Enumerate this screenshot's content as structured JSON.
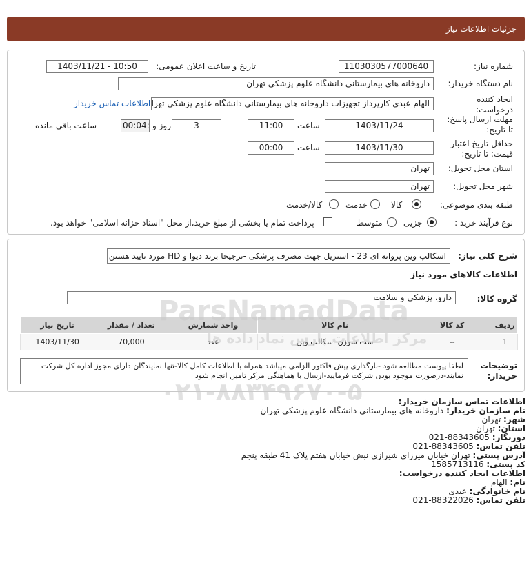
{
  "header": {
    "title": "جزئیات اطلاعات نیاز"
  },
  "form": {
    "need_number_label": "شماره نیاز:",
    "need_number": "1103030577000640",
    "announce_label": "تاریخ و ساعت اعلان عمومی:",
    "announce_value": "1403/11/21 - 10:50",
    "buyer_label": "نام دستگاه خریدار:",
    "buyer_value": "داروخانه های بیمارستانی دانشگاه علوم پزشکی تهران",
    "creator_label": "ایجاد کننده درخواست:",
    "creator_value": "الهام عبدی کارپرداز تجهیزات داروخانه های بیمارستانی دانشگاه علوم پزشکی تهران",
    "buyer_contact_link": "اطلاعات تماس خریدار",
    "deadline_label": "مهلت ارسال پاسخ: تا تاریخ:",
    "deadline_date": "1403/11/24",
    "time_label": "ساعت",
    "deadline_time": "11:00",
    "days_value": "3",
    "days_label": "روز و",
    "remaining_value": "00:04:35",
    "remaining_label": "ساعت باقی مانده",
    "validity_label": "حداقل تاریخ اعتبار قیمت: تا تاریخ:",
    "validity_date": "1403/11/30",
    "validity_time": "00:00",
    "province_label": "استان محل تحویل:",
    "province_value": "تهران",
    "city_label": "شهر محل تحویل:",
    "city_value": "تهران",
    "category_label": "طبقه بندی موضوعی:",
    "category_options": [
      "کالا",
      "خدمت",
      "کالا/خدمت"
    ],
    "category_selected": "کالا",
    "process_label": "نوع فرآیند خرید :",
    "process_options": [
      "جزیی",
      "متوسط"
    ],
    "process_selected": "جزیی",
    "payment_note": "پرداخت تمام یا بخشی از مبلغ خرید،از محل \"اسناد خزانه اسلامی\" خواهد بود."
  },
  "need": {
    "summary_label": "شرح کلی نیاز:",
    "summary_value": "اسکالپ وین پروانه ای 23 - استریل جهت مصرف پزشکی -ترجیحا برند دیوا و HD مورد تایید هستن",
    "goods_info_title": "اطلاعات کالاهای مورد نیاز",
    "group_label": "گروه کالا:",
    "group_value": "دارو، پزشکی و سلامت"
  },
  "table": {
    "headers": [
      "ردیف",
      "کد کالا",
      "نام کالا",
      "واحد شمارش",
      "تعداد / مقدار",
      "تاریخ نیاز"
    ],
    "rows": [
      {
        "index": "1",
        "code": "--",
        "name": "ست سوزن اسکالپ وین",
        "unit": "عدد",
        "qty": "70,000",
        "date": "1403/11/30"
      }
    ]
  },
  "notes": {
    "label": "توضیحات خریدار:",
    "text": "لطفا پیوست مطالعه شود -بارگذاری پیش فاکتور الزامی میباشد همراه با اطلاعات کامل کالا-تنها نمایندگان دارای مجوز اداره کل شرکت نمایند-درصورت موجود بودن شرکت فرمایید-ارسال با هماهنگی مرکز تامین انجام شود"
  },
  "contact": {
    "title": "اطلاعات تماس سازمان خریدار:",
    "org_label": "نام سازمان خریدار:",
    "org_value": "داروخانه های بیمارستانی دانشگاه علوم پزشکی تهران",
    "city_label": "شهر:",
    "city_value": "تهران",
    "province_label": "استان:",
    "province_value": "تهران",
    "fax_label": "دورنگار:",
    "fax_value": "021-88343605",
    "phone_label": "تلفن تماس:",
    "phone_value": "021-88343605",
    "address_label": "آدرس پستی:",
    "address_value": "تهران خیابان میرزای شیرازی نبش خیابان هفتم پلاک 41 طبقه پنجم",
    "postal_label": "کد پستی:",
    "postal_value": "1585713116",
    "creator_title": "اطلاعات ایجاد کننده درخواست:",
    "name_label": "نام:",
    "name_value": "الهام",
    "family_label": "نام خانوادگی:",
    "family_value": "عبدی",
    "creator_phone_label": "تلفن تماس:",
    "creator_phone_value": "021-88322026"
  },
  "watermark": {
    "brand": "ParsNamadData",
    "brand_fa": "مرکز اطلاعات پارس نماد داده ها",
    "phone": "۰۲۱-۸۸۳۴۹۶۷۰-۵"
  }
}
